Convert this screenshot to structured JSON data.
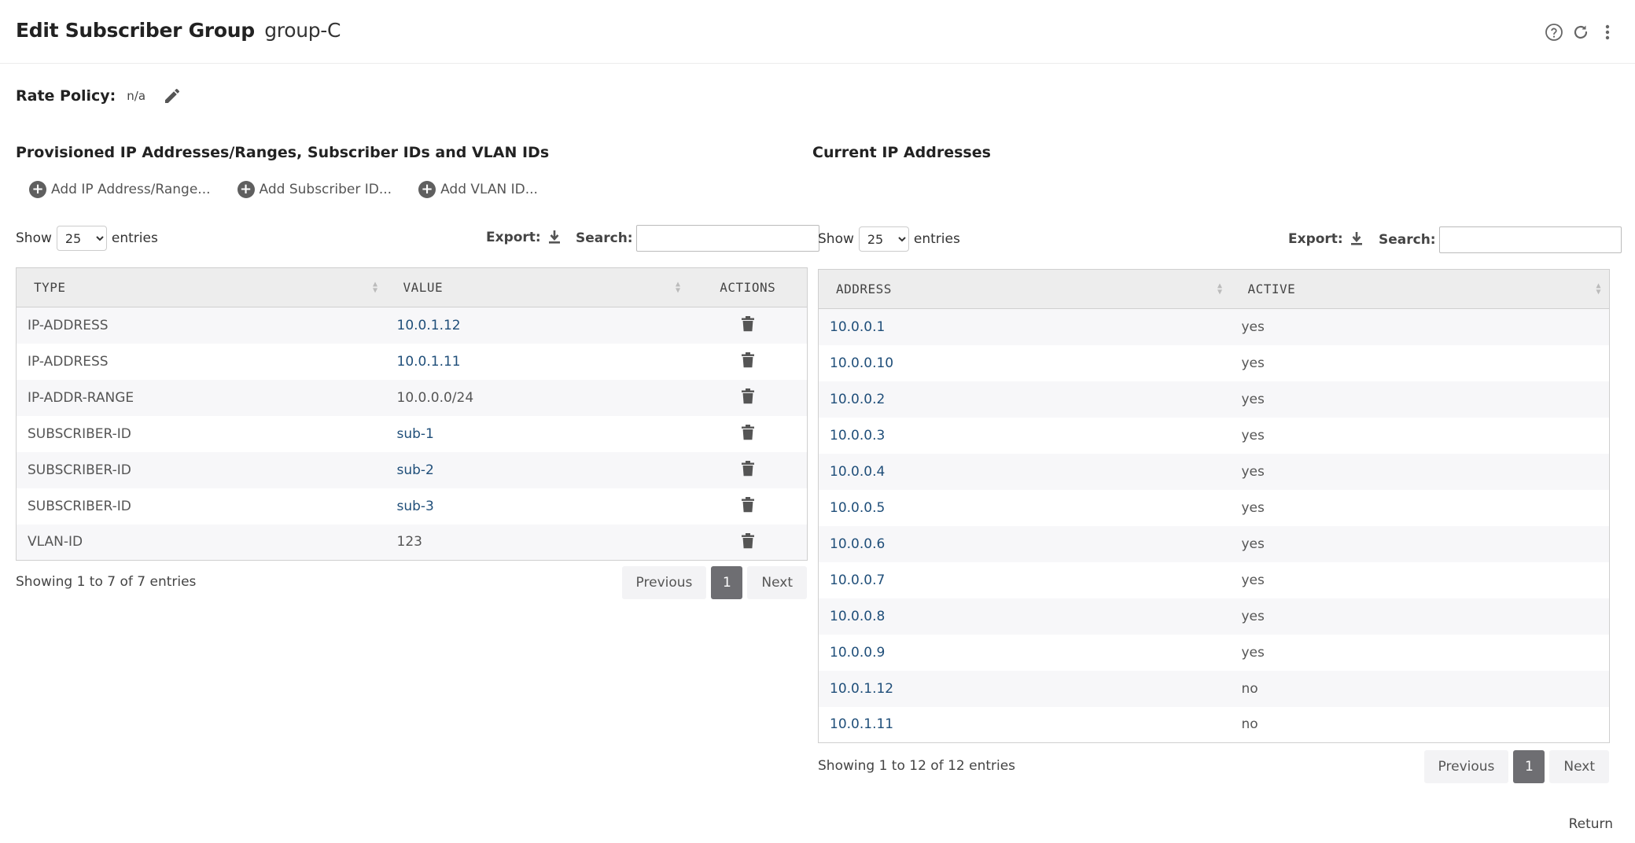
{
  "header": {
    "title": "Edit Subscriber Group",
    "group_name": "group-C",
    "icons": [
      "help-icon",
      "refresh-icon",
      "more-vertical-icon"
    ]
  },
  "rate_policy": {
    "label": "Rate Policy:",
    "value": "n/a"
  },
  "provisioned": {
    "title": "Provisioned IP Addresses/Ranges, Subscriber IDs and VLAN IDs",
    "add_buttons": [
      "Add IP Address/Range...",
      "Add Subscriber ID...",
      "Add VLAN ID..."
    ],
    "show_label": "Show",
    "page_size": "25",
    "entries_label": "entries",
    "export_label": "Export:",
    "search_label": "Search:",
    "search_value": "",
    "columns": [
      "TYPE",
      "VALUE",
      "ACTIONS"
    ],
    "rows": [
      {
        "type": "IP-ADDRESS",
        "value": "10.0.1.12",
        "is_link": true
      },
      {
        "type": "IP-ADDRESS",
        "value": "10.0.1.11",
        "is_link": true
      },
      {
        "type": "IP-ADDR-RANGE",
        "value": "10.0.0.0/24",
        "is_link": false
      },
      {
        "type": "SUBSCRIBER-ID",
        "value": "sub-1",
        "is_link": true
      },
      {
        "type": "SUBSCRIBER-ID",
        "value": "sub-2",
        "is_link": true
      },
      {
        "type": "SUBSCRIBER-ID",
        "value": "sub-3",
        "is_link": true
      },
      {
        "type": "VLAN-ID",
        "value": "123",
        "is_link": false
      }
    ],
    "info": "Showing 1 to 7 of 7 entries",
    "pager": {
      "previous": "Previous",
      "current": "1",
      "next": "Next"
    }
  },
  "current": {
    "title": "Current IP Addresses",
    "show_label": "Show",
    "page_size": "25",
    "entries_label": "entries",
    "export_label": "Export:",
    "search_label": "Search:",
    "search_value": "",
    "columns": [
      "ADDRESS",
      "ACTIVE"
    ],
    "rows": [
      {
        "address": "10.0.0.1",
        "active": "yes"
      },
      {
        "address": "10.0.0.10",
        "active": "yes"
      },
      {
        "address": "10.0.0.2",
        "active": "yes"
      },
      {
        "address": "10.0.0.3",
        "active": "yes"
      },
      {
        "address": "10.0.0.4",
        "active": "yes"
      },
      {
        "address": "10.0.0.5",
        "active": "yes"
      },
      {
        "address": "10.0.0.6",
        "active": "yes"
      },
      {
        "address": "10.0.0.7",
        "active": "yes"
      },
      {
        "address": "10.0.0.8",
        "active": "yes"
      },
      {
        "address": "10.0.0.9",
        "active": "yes"
      },
      {
        "address": "10.0.1.12",
        "active": "no"
      },
      {
        "address": "10.0.1.11",
        "active": "no"
      }
    ],
    "info": "Showing 1 to 12 of 12 entries",
    "pager": {
      "previous": "Previous",
      "current": "1",
      "next": "Next"
    }
  },
  "footer": {
    "return_label": "Return"
  },
  "colors": {
    "link": "#1f4e79",
    "header_bg": "#ededed",
    "row_stripe": "#f7f7f9",
    "page_current": "#6e6e72"
  }
}
